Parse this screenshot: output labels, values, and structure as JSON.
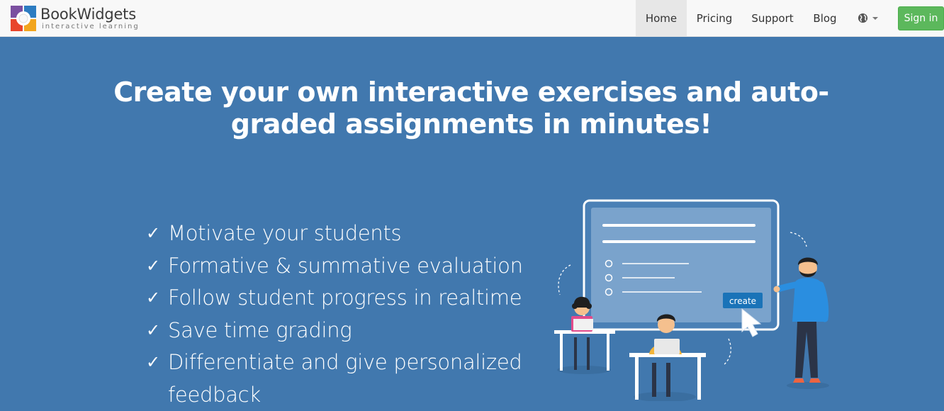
{
  "brand": {
    "name": "BookWidgets",
    "tagline": "interactive learning"
  },
  "nav": {
    "items": [
      {
        "label": "Home",
        "active": true
      },
      {
        "label": "Pricing"
      },
      {
        "label": "Support"
      },
      {
        "label": "Blog"
      }
    ],
    "language_icon": "globe-icon",
    "signin_label": "Sign in"
  },
  "hero": {
    "title": "Create your own interactive exercises and auto-graded assignments in minutes!",
    "features": [
      "Motivate your students",
      "Formative & summative evaluation",
      "Follow student progress in realtime",
      "Save time grading",
      "Differentiate and give personalized feedback"
    ],
    "check_symbol": "✓"
  },
  "illustration": {
    "button_label": "create"
  },
  "colors": {
    "hero_bg": "#4178ae",
    "signin_bg": "#5cb85c",
    "create_btn": "#1a73b8",
    "teacher_shirt": "#2a8ee0"
  }
}
